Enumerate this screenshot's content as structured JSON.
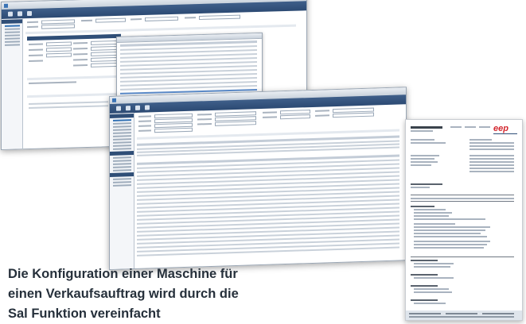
{
  "caption": {
    "lines": [
      "Die Konfiguration einer Maschine für",
      "einen Verkaufsauftrag wird durch die",
      "Sal Funktion vereinfacht"
    ]
  },
  "colors": {
    "ribbon": "#2c4a73",
    "navigation_header": "#2f4e77",
    "selected_row": "#5d8fd0",
    "logo_red": "#d3262e",
    "caption_text": "#26303b"
  },
  "icons": [
    "window-icon",
    "document-logo-icon"
  ],
  "document": {
    "logo_text": "eep"
  }
}
